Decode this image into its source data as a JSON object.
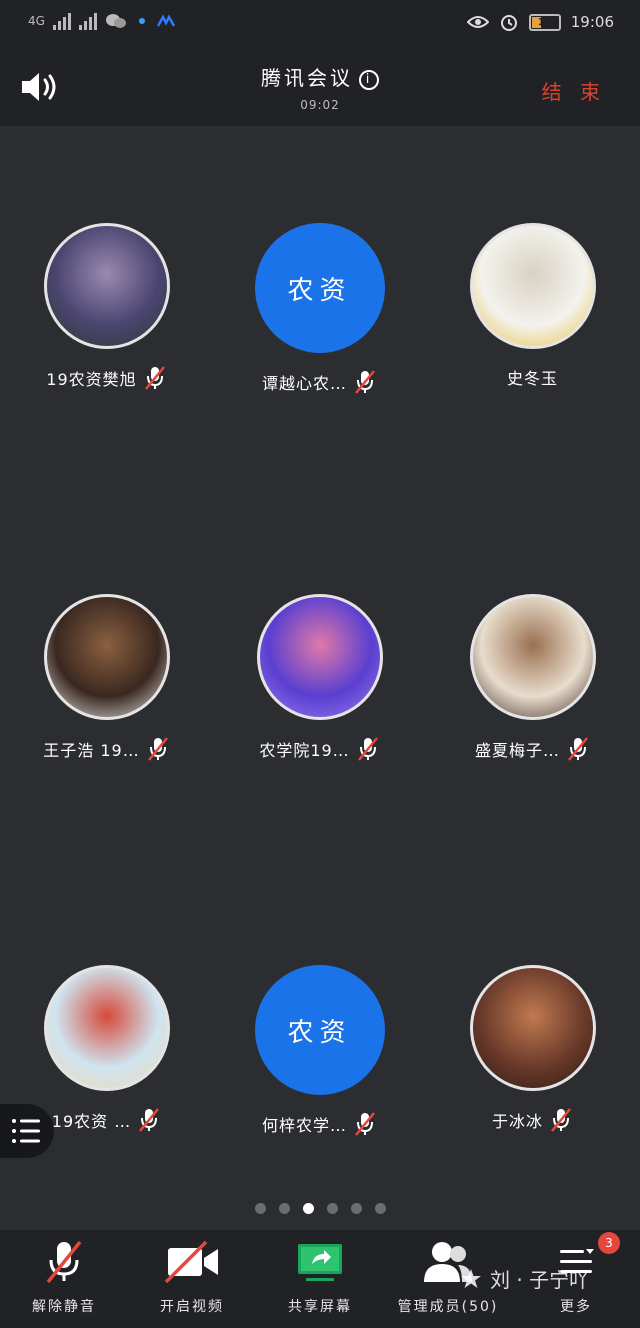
{
  "status_bar": {
    "network": "4G",
    "battery_level": "17",
    "time": "19:06",
    "icons": [
      "signal-icon",
      "wechat-icon",
      "eye-icon",
      "alarm-icon",
      "battery-icon"
    ]
  },
  "header": {
    "title": "腾讯会议",
    "timer": "09:02",
    "end_label": "结 束",
    "speaker_icon": "speaker-icon",
    "info_icon": "info-icon"
  },
  "participants": [
    {
      "name": "19农资樊旭",
      "muted": true,
      "avatar_text": "",
      "avatar_colors": [
        "#4a4570",
        "#9a8ab0",
        "#2d3a2e"
      ]
    },
    {
      "name": "谭越心农…",
      "muted": true,
      "avatar_text": "农资",
      "avatar_colors": [
        "#1a73e8"
      ]
    },
    {
      "name": "史冬玉",
      "muted": false,
      "avatar_text": "",
      "avatar_colors": [
        "#f4f2ee",
        "#d8d2c2",
        "#e6c040"
      ]
    },
    {
      "name": "王子浩 19…",
      "muted": true,
      "avatar_text": "",
      "avatar_colors": [
        "#3a2820",
        "#8a6040",
        "#f0f0f0"
      ]
    },
    {
      "name": "农学院19…",
      "muted": true,
      "avatar_text": "",
      "avatar_colors": [
        "#5a3fd0",
        "#e07aa8",
        "#9b7cf0"
      ]
    },
    {
      "name": "盛夏梅子…",
      "muted": true,
      "avatar_text": "",
      "avatar_colors": [
        "#e8dccc",
        "#9a7050",
        "#3a2a24"
      ]
    },
    {
      "name": "19农资 …",
      "muted": true,
      "avatar_text": "",
      "avatar_colors": [
        "#cfe4f0",
        "#d64a3a",
        "#f0d8b0"
      ]
    },
    {
      "name": "何梓农学…",
      "muted": true,
      "avatar_text": "农资",
      "avatar_colors": [
        "#1a73e8"
      ]
    },
    {
      "name": "于冰冰",
      "muted": true,
      "avatar_text": "",
      "avatar_colors": [
        "#6a3a2a",
        "#c07a50",
        "#2a1a14"
      ]
    }
  ],
  "pager": {
    "total": 6,
    "active_index": 2
  },
  "bottom_bar": {
    "items": [
      {
        "label": "解除静音",
        "icon": "mic-off-icon"
      },
      {
        "label": "开启视频",
        "icon": "camera-off-icon"
      },
      {
        "label": "共享屏幕",
        "icon": "share-screen-icon"
      },
      {
        "label": "管理成员(50)",
        "icon": "members-icon"
      },
      {
        "label": "更多",
        "icon": "more-icon",
        "badge": "3"
      }
    ]
  },
  "watermark": "刘 · 子宁吖",
  "colors": {
    "accent_blue": "#1a73e8",
    "end_red": "#e0402e",
    "background": "#2b2d31",
    "bar": "#212226"
  }
}
